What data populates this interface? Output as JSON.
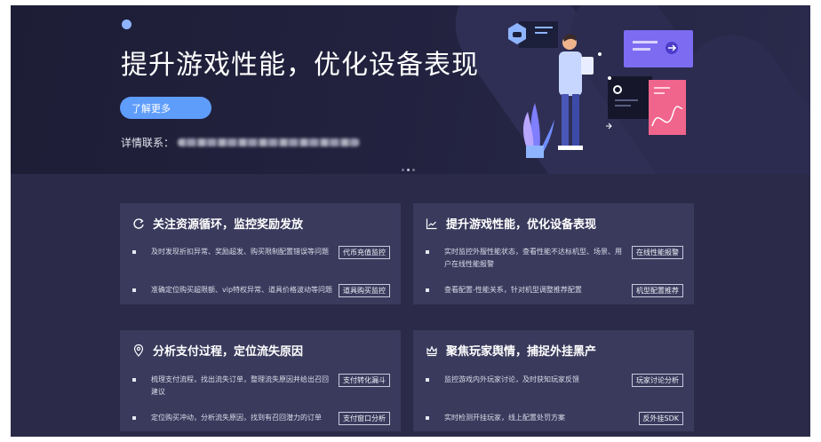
{
  "hero": {
    "title": "提升游戏性能，优化设备表现",
    "button_label": "了解更多",
    "contact_label": "详情联系："
  },
  "cards": [
    {
      "title": "关注资源循环，监控奖励发放",
      "icon": "cycle-icon",
      "rows": [
        {
          "text": "及时发现折扣异常、奖励超发、购买限制配置错误等问题",
          "button": "代币充值监控"
        },
        {
          "text": "准确定位购买超限额、vip特权异常、道具价格波动等问题",
          "button": "道具购买监控"
        }
      ]
    },
    {
      "title": "提升游戏性能，优化设备表现",
      "icon": "line-chart-icon",
      "rows": [
        {
          "text": "实时监控外服性能状态，查看性能不达标机型、场景、用户在线性能报警",
          "button": "在线性能报警"
        },
        {
          "text": "查看配置-性能关系，针对机型调整推荐配置",
          "button": "机型配置推荐"
        }
      ]
    },
    {
      "title": "分析支付过程，定位流失原因",
      "icon": "location-pin-icon",
      "rows": [
        {
          "text": "梳理支付流程，找出流失订单，整理流失原因并给出召回建议",
          "button": "支付转化漏斗"
        },
        {
          "text": "定位购买冲动，分析流失原因，找到有召回潜力的订单",
          "button": "支付窗口分析"
        }
      ]
    },
    {
      "title": "聚焦玩家舆情，捕捉外挂黑产",
      "icon": "crown-icon",
      "rows": [
        {
          "text": "监控游戏内外玩家讨论，及时获知玩家反馈",
          "button": "玩家讨论分析"
        },
        {
          "text": "实时检测开挂玩家，线上配置处罚方案",
          "button": "反外挂SDK"
        }
      ]
    }
  ],
  "colors": {
    "accent": "#5f9dfb",
    "hero_bg": "#1d1d36",
    "card_bg": "#393a5c",
    "page_bg": "#2b2b49"
  }
}
